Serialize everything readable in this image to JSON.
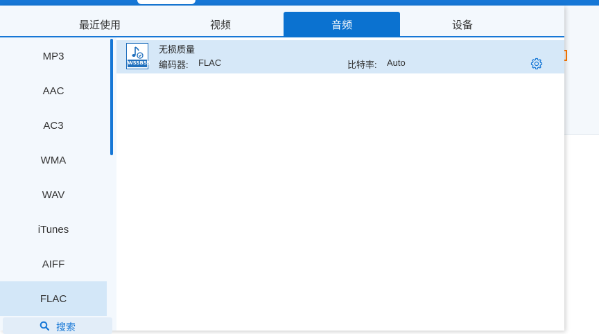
{
  "tabs": [
    {
      "label": "最近使用",
      "active": false
    },
    {
      "label": "视频",
      "active": false
    },
    {
      "label": "音频",
      "active": true
    },
    {
      "label": "设备",
      "active": false
    }
  ],
  "sidebar": {
    "items": [
      {
        "label": "MP3"
      },
      {
        "label": "AAC"
      },
      {
        "label": "AC3"
      },
      {
        "label": "WMA"
      },
      {
        "label": "WAV"
      },
      {
        "label": "iTunes"
      },
      {
        "label": "AIFF"
      },
      {
        "label": "FLAC",
        "selected": true
      }
    ],
    "search_label": "搜索"
  },
  "preset": {
    "name": "无损质量",
    "encoder_label": "编码器:",
    "encoder_value": "FLAC",
    "bitrate_label": "比特率:",
    "bitrate_value": "Auto",
    "icon": "audio-file-icon",
    "icon_tag": "WSSBSS"
  },
  "colors": {
    "accent": "#0b72d0",
    "selected_bg": "#d6e8f8",
    "panel_bg": "#f3f8fd"
  }
}
